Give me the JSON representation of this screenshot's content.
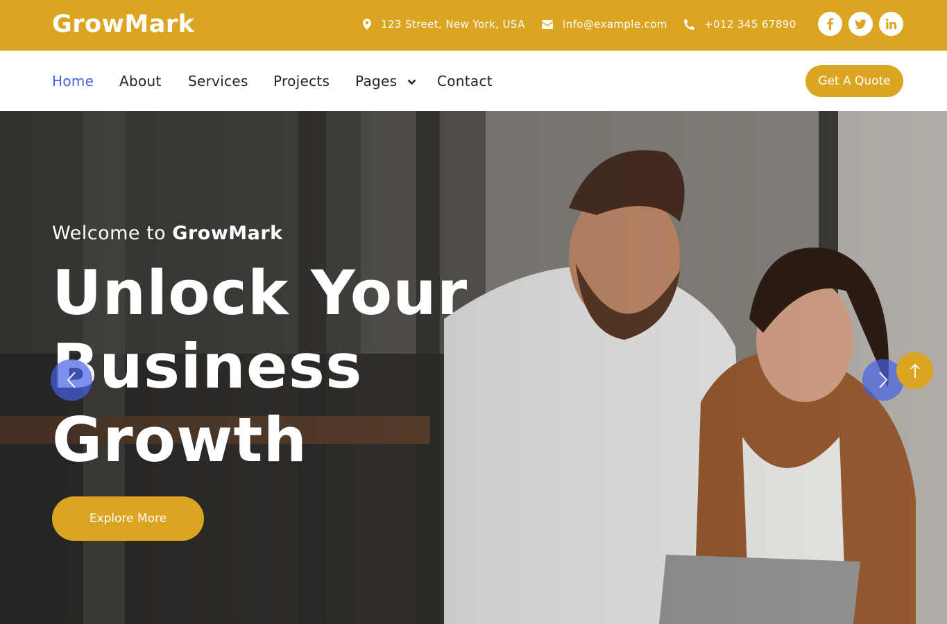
{
  "brand": {
    "name": "GrowMark"
  },
  "topbar": {
    "address": "123 Street, New York, USA",
    "email": "info@example.com",
    "phone": "+012 345 67890",
    "social": [
      {
        "icon": "facebook-icon"
      },
      {
        "icon": "twitter-icon"
      },
      {
        "icon": "linkedin-icon"
      }
    ]
  },
  "nav": {
    "items": [
      {
        "label": "Home",
        "active": true
      },
      {
        "label": "About"
      },
      {
        "label": "Services"
      },
      {
        "label": "Projects"
      },
      {
        "label": "Pages",
        "dropdown": true
      },
      {
        "label": "Contact"
      }
    ],
    "cta": "Get A Quote"
  },
  "hero": {
    "welcome_prefix": "Welcome to",
    "welcome_brand": "GrowMark",
    "headline": "Unlock Your Business Growth",
    "button": "Explore More"
  },
  "colors": {
    "accent": "#dba521",
    "active_link": "#4761e6",
    "carousel_control": "#4761e6"
  }
}
